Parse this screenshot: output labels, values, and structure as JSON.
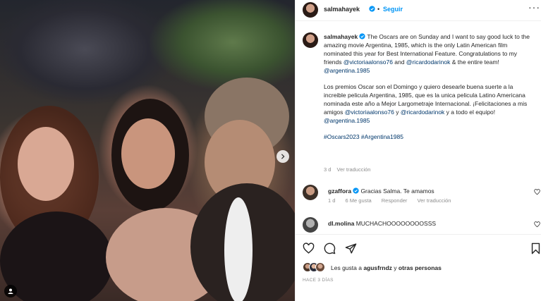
{
  "post_author": {
    "username": "salmahayek",
    "follow_label": "Seguir",
    "separator": "•",
    "more_label": "···"
  },
  "caption": {
    "username": "salmahayek",
    "paragraph_en_1": " The Oscars are on Sunday and I want to say good luck to the amazing movie Argentina, 1985, which is the only Latin American film nominated this year for Best International Feature. Congratulations to my friends ",
    "mention_1": "@victoriaalonso76",
    "paragraph_en_2": " and ",
    "mention_2": "@ricardodarinok",
    "paragraph_en_3": " & the entire team! ",
    "mention_3": "@argentina.1985",
    "paragraph_es_1": "Los premios Oscar son el Domingo y quiero desearle buena suerte a la increible pelicula Argentina, 1985, que es la unica pelicula Latino Americana nominada este año a Mejor Largometraje Internacional. ¡Felicitaciones a mis amigos ",
    "mention_4": "@victoriaalonso76",
    "paragraph_es_2": " y ",
    "mention_5": "@ricardodarinok",
    "paragraph_es_3": " y a todo el equipo! ",
    "mention_6": "@argentina.1985",
    "hashtags": "#Oscars2023 #Argentina1985",
    "time": "3 d",
    "translate_label": "Ver traducción"
  },
  "comments": [
    {
      "username": "gzaffora",
      "text": "Gracias Salma. Te amamos",
      "time": "1 d",
      "likes": "6 Me gusta",
      "reply_label": "Responder",
      "translate_label": "Ver traducción"
    },
    {
      "username": "dl.molina",
      "text": "MUCHACHOOOOOOOOSSS"
    }
  ],
  "likes": {
    "prefix": "Les gusta a ",
    "user": "agusfrndz",
    "middle": " y ",
    "others": "otras personas"
  },
  "posted_ago": "HACE 3 DÍAS",
  "colors": {
    "accent": "#0095f6",
    "mention": "#00376b",
    "muted": "#8e8e8e",
    "text": "#262626"
  },
  "icons": [
    "verified-badge-icon",
    "more-options-icon",
    "heart-icon",
    "comment-icon",
    "share-icon",
    "bookmark-icon",
    "chevron-right-icon",
    "tag-user-icon"
  ]
}
